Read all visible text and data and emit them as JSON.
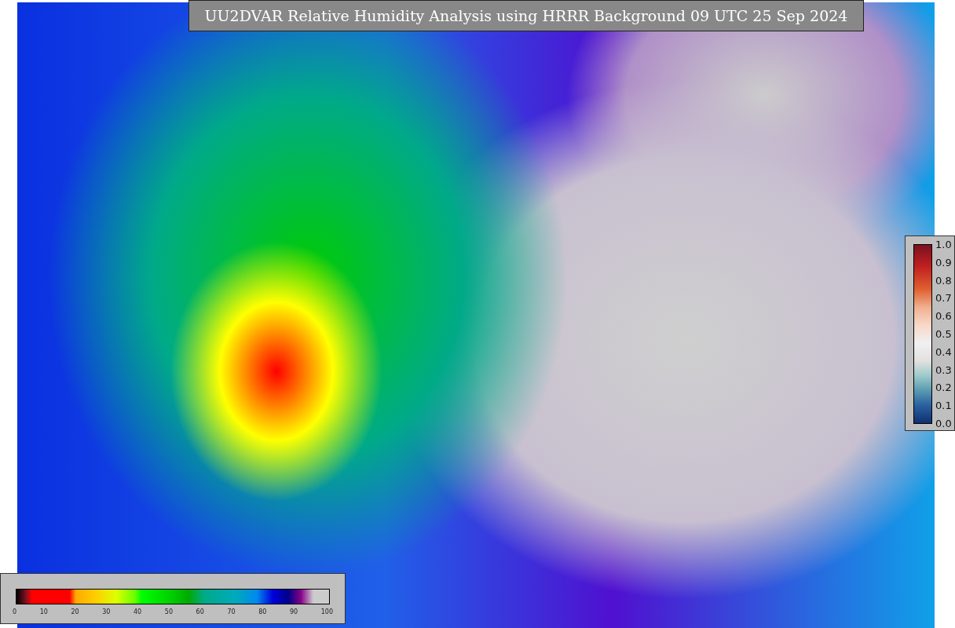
{
  "title": "UU2DVAR Relative Humidity Analysis using HRRR Background 09 UTC 25 Sep 2024",
  "humidity_scale": {
    "ticks": [
      "0",
      "10",
      "20",
      "30",
      "40",
      "50",
      "60",
      "70",
      "80",
      "90",
      "100"
    ]
  },
  "observation_scale": {
    "ticks": [
      "1.0",
      "0.9",
      "0.8",
      "0.7",
      "0.6",
      "0.5",
      "0.4",
      "0.3",
      "0.2",
      "0.1",
      "0.0"
    ]
  }
}
